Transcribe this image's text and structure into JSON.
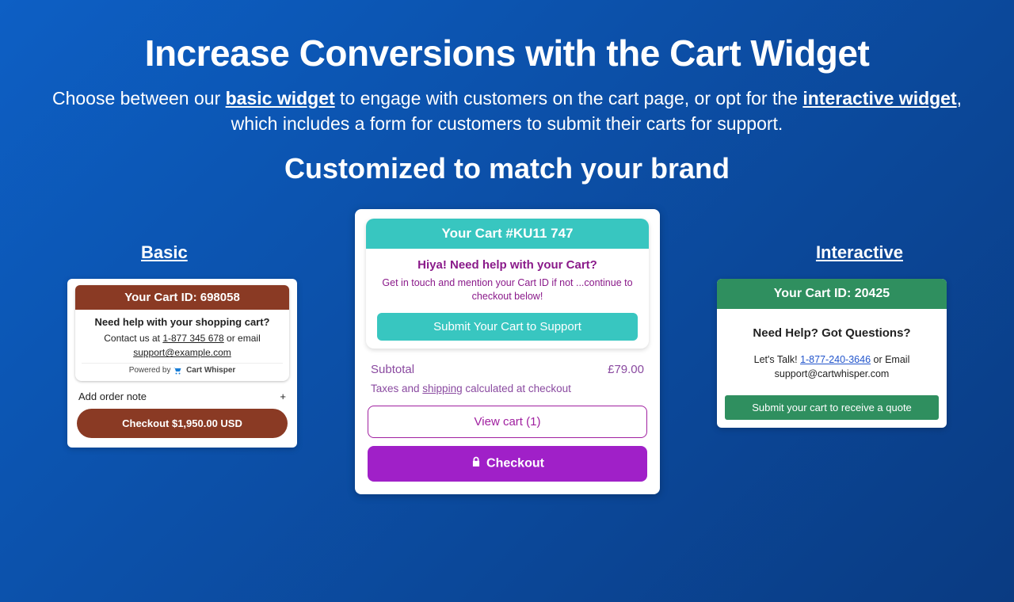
{
  "headline": "Increase Conversions with the Cart Widget",
  "subtext_prefix": "Choose between our ",
  "subtext_basic": "basic widget",
  "subtext_mid1": " to engage with customers on the cart page, or opt for the ",
  "subtext_interactive": "interactive widget",
  "subtext_suffix": ", which includes a form for customers to submit their carts for support.",
  "customize": "Customized to match your brand",
  "labels": {
    "basic": "Basic",
    "interactive": "Interactive"
  },
  "basic": {
    "header": "Your Cart ID: 698058",
    "help": "Need help with your shopping cart?",
    "contact_prefix": "Contact us at ",
    "phone": "1-877 345 678",
    "contact_suffix": " or email",
    "email": "support@example.com",
    "powered": "Powered by",
    "brand": "Cart Whisper",
    "note": "Add order note",
    "plus": "+",
    "checkout": "Checkout $1,950.00 USD"
  },
  "mid": {
    "header": "Your Cart #KU11 747",
    "hiya": "Hiya! Need help with your Cart?",
    "touch": "Get in touch and mention your Cart ID if not ...continue to checkout below!",
    "submit": "Submit Your Cart to Support",
    "sub_label": "Subtotal",
    "sub_value": "£79.00",
    "tax_prefix": "Taxes and ",
    "tax_link": "shipping",
    "tax_suffix": " calculated at checkout",
    "view": "View cart (1)",
    "checkout": "Checkout"
  },
  "int": {
    "header": "Your Cart ID: 20425",
    "help": "Need Help? Got Questions?",
    "talk_prefix": "Let's Talk! ",
    "phone": "1-877-240-3646",
    "talk_suffix": " or Email",
    "email": "support@cartwhisper.com",
    "submit": "Submit your cart to receive a quote"
  }
}
